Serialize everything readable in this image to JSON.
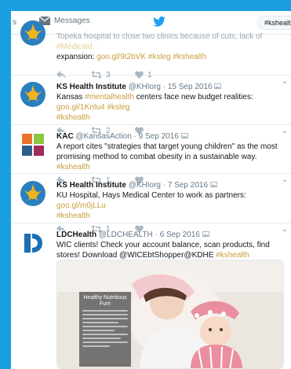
{
  "topbar": {
    "edge_label": "s",
    "messages_label": "Messages",
    "search_value": "#kshealth"
  },
  "tweets": [
    {
      "text_prefix": "Topeka hospital to close two clinics because of cuts, lack of ",
      "text_tag_faded": "#Medicaid",
      "text_mid": "expansion: ",
      "link": "goo.gl/9t2bVK",
      "tags": "#ksleg #kshealth",
      "retweets": "3",
      "likes": "1"
    },
    {
      "name": "KS Health Institute",
      "handle": "@KHIorg",
      "date": "· 15 Sep 2016",
      "text_prefix": "Kansas ",
      "text_tag1": "#mentalhealth",
      "text_mid": " centers face new budget realities: ",
      "link": "goo.gl/1Kntu4",
      "tag_after_link": " #ksleg",
      "tag_last": "#kshealth",
      "retweets": "2",
      "likes": ""
    },
    {
      "name": "KAC",
      "handle": "@KansasAction",
      "date": "· 9 Sep 2016",
      "text": "A report cites \"strategies that target young children\" as the most promising method to combat obesity in a sustainable way. ",
      "tag": "#kshealth",
      "retweets": "1",
      "likes": ""
    },
    {
      "name": "KS Health Institute",
      "handle": "@KHIorg",
      "date": "· 7 Sep 2016",
      "text": "KU Hospital, Hays Medical Center to work as partners: ",
      "link": "goo.gl/m0jLLu",
      "tag": "#kshealth",
      "retweets": "1",
      "likes": ""
    },
    {
      "name": "LDCHealth",
      "handle": "@LDCHEALTH",
      "date": "· 6 Sep 2016",
      "text": "WIC clients! Check your account balance, scan products, find stores! Download @WICEbtShopper@KDHE ",
      "tag": "#kshealth",
      "flyer_title": "Healthy Nutritious Fun!"
    }
  ],
  "colors": {
    "page_bg": "#1a9ee0",
    "twitter_blue": "#1da1f2",
    "link_gold": "#c9a03d",
    "khi_circle": "#2a7fbf",
    "khi_sun": "#f2b41c"
  }
}
